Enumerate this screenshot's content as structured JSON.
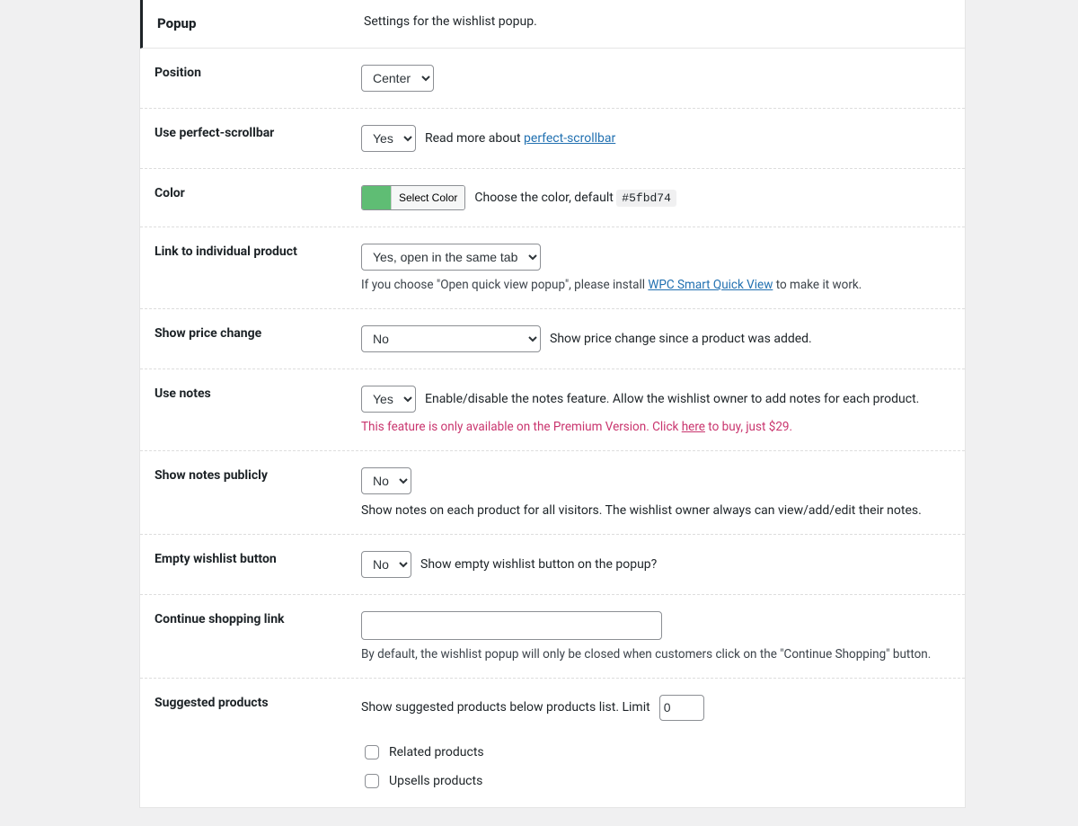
{
  "section": {
    "title": "Popup",
    "desc": "Settings for the wishlist popup."
  },
  "position": {
    "label": "Position",
    "value": "Center"
  },
  "scrollbar": {
    "label": "Use perfect-scrollbar",
    "value": "Yes",
    "help_prefix": "Read more about ",
    "help_link": "perfect-scrollbar"
  },
  "color": {
    "label": "Color",
    "button": "Select Color",
    "swatch": "#5fbd74",
    "help_prefix": "Choose the color, default ",
    "help_code": "#5fbd74"
  },
  "link_individual": {
    "label": "Link to individual product",
    "value": "Yes, open in the same tab",
    "help_prefix": "If you choose \"Open quick view popup\", please install ",
    "help_link": "WPC Smart Quick View",
    "help_suffix": " to make it work."
  },
  "price_change": {
    "label": "Show price change",
    "value": "No",
    "help": "Show price change since a product was added."
  },
  "use_notes": {
    "label": "Use notes",
    "value": "Yes",
    "help": "Enable/disable the notes feature. Allow the wishlist owner to add notes for each product.",
    "premium_prefix": "This feature is only available on the Premium Version. Click ",
    "premium_link": "here",
    "premium_suffix": " to buy, just $29."
  },
  "notes_public": {
    "label": "Show notes publicly",
    "value": "No",
    "help": "Show notes on each product for all visitors. The wishlist owner always can view/add/edit their notes."
  },
  "empty_btn": {
    "label": "Empty wishlist button",
    "value": "No",
    "help": "Show empty wishlist button on the popup?"
  },
  "continue": {
    "label": "Continue shopping link",
    "value": "",
    "help": "By default, the wishlist popup will only be closed when customers click on the \"Continue Shopping\" button."
  },
  "suggested": {
    "label": "Suggested products",
    "help_prefix": "Show suggested products below products list. Limit",
    "limit": "0",
    "cb_related": "Related products",
    "cb_upsells": "Upsells products"
  }
}
